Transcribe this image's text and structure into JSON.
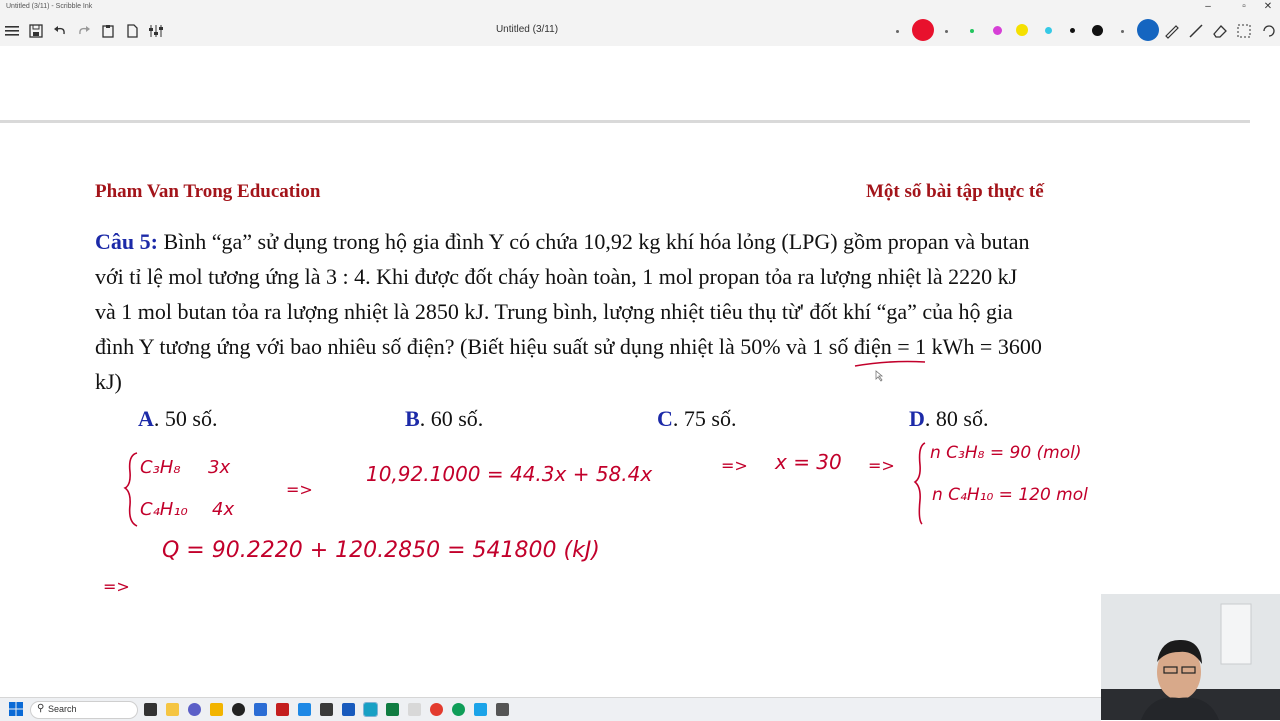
{
  "window": {
    "title": "Untitled (3/11) - Scribble Ink"
  },
  "toolbar": {
    "document_title": "Untitled (3/11)",
    "icons": [
      "menu-icon",
      "save-icon",
      "undo-icon",
      "redo-icon",
      "clipboard-icon",
      "page-icon",
      "settings-icon"
    ],
    "pen_colors": [
      "#e8112d",
      "#22c55e",
      "#d63fd6",
      "#f5e000",
      "#35c9e6",
      "#111111",
      "#111111"
    ],
    "tools": [
      "lasso-icon",
      "ruler-icon",
      "pen-icon",
      "eraser-icon",
      "select-icon",
      "undo-circle-icon"
    ]
  },
  "document": {
    "header_left": "Pham Van Trong Education",
    "header_right": "Một số bài tập thực tế",
    "question_label": "Câu 5:",
    "question_lines": [
      " Bình “ga” sử dụng trong hộ gia đình Y có chứa 10,92 kg khí hóa lỏng (LPG) gồm propan và butan",
      "với tỉ lệ mol tương ứng là 3 : 4. Khi được đốt cháy hoàn toàn, 1 mol propan tỏa ra lượng nhiệt là 2220 kJ",
      "và 1 mol butan tỏa ra lượng nhiệt là 2850 kJ. Trung bình, lượng nhiệt tiêu thụ từ' đốt khí “ga” của hộ gia",
      "đình Y tương ứng với bao nhiêu số điện? (Biết hiệu suất sử dụng nhiệt là 50% và 1 số điện = 1 kWh = 3600",
      "kJ)"
    ],
    "options": [
      {
        "letter": "A",
        "text": ". 50 số."
      },
      {
        "letter": "B",
        "text": ". 60 số."
      },
      {
        "letter": "C",
        "text": ". 75 số."
      },
      {
        "letter": "D",
        "text": ". 80 số."
      }
    ]
  },
  "handwriting": {
    "c3h8": "C₃H₈",
    "c3h8_val": "3x",
    "c4h10": "C₄H₁₀",
    "c4h10_val": "4x",
    "arrow1": "=>",
    "equation": "10,92.1000 = 44.3x + 58.4x",
    "arrow2": "=>",
    "x_result": "x = 30",
    "arrow3": "=>",
    "n_c3h8": "n C₃H₈ = 90 (mol)",
    "n_c4h10": "n C₄H₁₀ = 120 mol",
    "arrow4": "=>",
    "q_line": "Q = 90.2220 + 120.2850 = 541800 (kJ)"
  },
  "taskbar": {
    "search_placeholder": "Search"
  }
}
